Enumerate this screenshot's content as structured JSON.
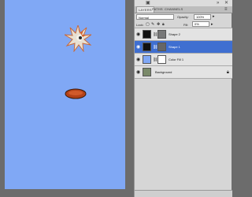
{
  "panel": {
    "tabs": [
      {
        "label": "LAYERS",
        "active": true
      },
      {
        "label": "PATHS",
        "active": false
      },
      {
        "label": "CHANNELS",
        "active": false
      }
    ],
    "blend_mode": "Normal",
    "opacity_label": "Opacity:",
    "opacity_value": "100%",
    "lock_label": "Lock:",
    "fill_label": "Fill:",
    "fill_value": "0%"
  },
  "layers": [
    {
      "name": "Shape 2",
      "selected": false
    },
    {
      "name": "Shape 1",
      "selected": true
    },
    {
      "name": "Color Fill 1",
      "selected": false
    },
    {
      "name": "Background",
      "selected": false
    }
  ],
  "colors": {
    "canvas": "#80a8f5",
    "selection": "#3f6fd1",
    "panel": "#d6d6d6",
    "workspace": "#6c6c6c"
  }
}
